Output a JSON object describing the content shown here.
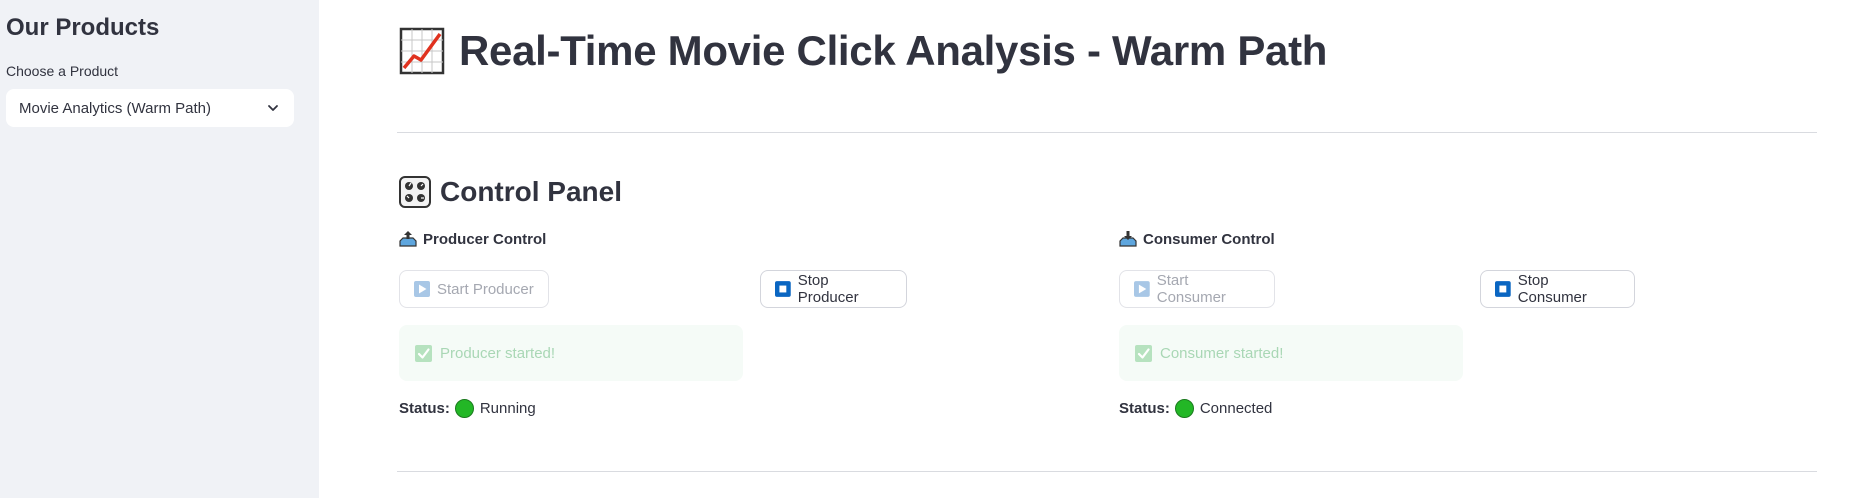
{
  "sidebar": {
    "title": "Our Products",
    "select_label": "Choose a Product",
    "selected_product": "Movie Analytics (Warm Path)"
  },
  "page": {
    "title": "Real-Time Movie Click Analysis - Warm Path",
    "title_icon": "chart-increasing-icon"
  },
  "control_panel": {
    "title": "Control Panel",
    "title_icon": "control-knobs-icon",
    "producer": {
      "heading": "Producer Control",
      "start_label": "Start Producer",
      "stop_label": "Stop Producer",
      "message": "Producer started!",
      "status_label": "Status:",
      "status_value": "Running",
      "status_color": "#23b726"
    },
    "consumer": {
      "heading": "Consumer Control",
      "start_label": "Start Consumer",
      "stop_label": "Stop Consumer",
      "message": "Consumer started!",
      "status_label": "Status:",
      "status_value": "Connected",
      "status_color": "#23b726"
    }
  },
  "colors": {
    "sidebar_bg": "#f0f2f6",
    "success_bg": "#f5fbf7",
    "stop_icon_blue": "#0a66c2"
  }
}
